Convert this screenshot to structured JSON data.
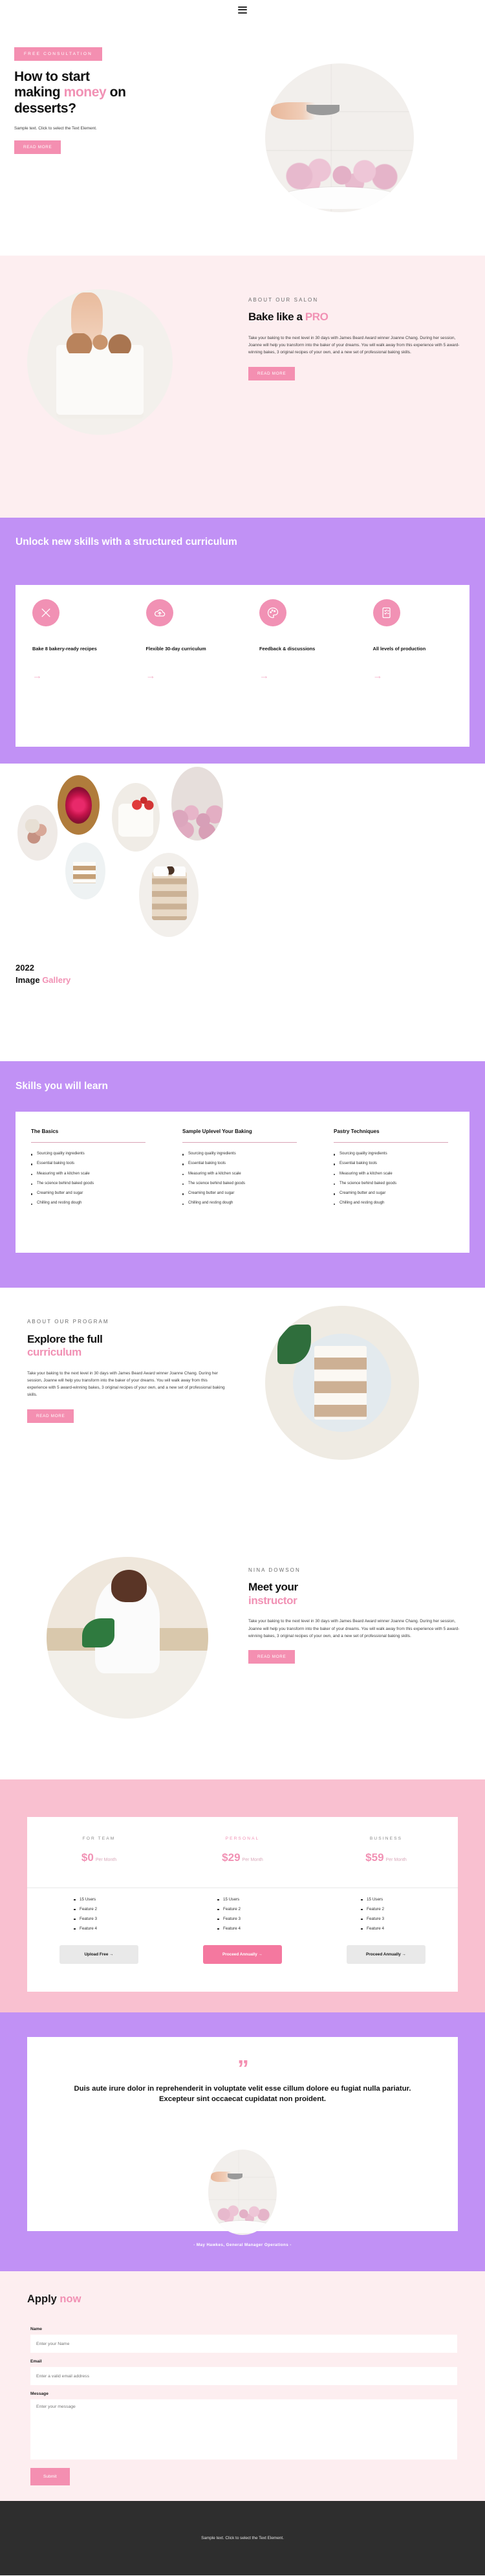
{
  "nav": {
    "menu_icon": "hamburger-menu-icon"
  },
  "hero": {
    "tag": "FREE CONSULTATION",
    "title_1": "How to start",
    "title_2a": "making ",
    "title_2b": "money",
    "title_2c": " on",
    "title_3": "desserts?",
    "body": "Sample text. Click to select the Text Element.",
    "cta": "READ MORE",
    "image": "meringues-on-cake-stand-photo"
  },
  "salon": {
    "eyebrow": "ABOUT OUR SALON",
    "title_a": "Bake like a ",
    "title_b": "PRO",
    "body": "Take your baking to the next level in 30 days with James Beard Award winner Joanne Chang. During her session, Joanne will help you transform into the baker of your dreams. You will walk away from this experience with 5 award-winning bakes, 3 original recipes of your own, and a new set of professional baking skills.",
    "cta": "READ MORE",
    "image": "baker-decorating-cake-photo"
  },
  "unlock": {
    "title": "Unlock new skills with a structured curriculum",
    "cards": [
      {
        "icon": "whisk-icon",
        "title": "Bake 8 bakery-ready recipes",
        "arrow": "→"
      },
      {
        "icon": "cloud-upload-icon",
        "title": "Flexible 30-day curriculum",
        "arrow": "→"
      },
      {
        "icon": "palette-icon",
        "title": "Feedback & discussions",
        "arrow": "→"
      },
      {
        "icon": "checklist-icon",
        "title": "All levels of production",
        "arrow": "→"
      }
    ]
  },
  "gallery": {
    "year": "2022",
    "title_a": "Image ",
    "title_b": "Gallery",
    "images": [
      "macarons-on-plate-photo",
      "red-rose-cake-photo",
      "berry-cheesecake-photo",
      "pink-meringues-photo",
      "layered-cake-slice-photo",
      "chocolate-layer-cake-photo"
    ]
  },
  "skills": {
    "title": "Skills you will learn",
    "columns": [
      {
        "heading": "The Basics",
        "items": [
          "Sourcing quality ingredients",
          "Essential baking tools",
          "Measuring with a kitchen scale",
          "The science behind baked goods",
          "Creaming butter and sugar",
          "Chilling and resting dough"
        ]
      },
      {
        "heading": "Sample Uplevel Your Baking",
        "items": [
          "Sourcing quality ingredients",
          "Essential baking tools",
          "Measuring with a kitchen scale",
          "The science behind baked goods",
          "Creaming butter and sugar",
          "Chilling and resting dough"
        ]
      },
      {
        "heading": "Pastry Techniques",
        "items": [
          "Sourcing quality ingredients",
          "Essential baking tools",
          "Measuring with a kitchen scale",
          "The science behind baked goods",
          "Creaming butter and sugar",
          "Chilling and resting dough"
        ]
      }
    ]
  },
  "explore": {
    "eyebrow": "ABOUT OUR PROGRAM",
    "title_a": "Explore the full",
    "title_b": "curriculum",
    "body": "Take your baking to the next level in 30 days with James Beard Award winner Joanne Chang. During her session, Joanne will help you transform into the baker of your dreams. You will walk away from this experience with 5 award-winning bakes, 3 original recipes of your own, and a new set of professional baking skills.",
    "cta": "READ MORE",
    "image": "cake-slice-on-plate-photo"
  },
  "instructor": {
    "eyebrow": "NINA DOWSON",
    "title_a": "Meet your",
    "title_b": "instructor",
    "body": "Take your baking to the next level in 30 days with James Beard Award winner Joanne Chang. During her session, Joanne will help you transform into the baker of your dreams. You will walk away from this experience with 5 award-winning bakes, 3 original recipes of your own, and a new set of professional baking skills.",
    "cta": "READ MORE",
    "image": "pastry-chef-piping-photo"
  },
  "pricing": {
    "plans": [
      {
        "label": "FOR TEAM",
        "amount": "$0",
        "period": "Per Month",
        "features": [
          "15 Users",
          "Feature 2",
          "Feature 3",
          "Feature 4"
        ],
        "button": "Upload Free →"
      },
      {
        "label": "PERSONAL",
        "amount": "$29",
        "period": "Per Month",
        "features": [
          "15 Users",
          "Feature 2",
          "Feature 3",
          "Feature 4"
        ],
        "button": "Proceed Annually →"
      },
      {
        "label": "BUSINESS",
        "amount": "$59",
        "period": "Per Month",
        "features": [
          "15 Users",
          "Feature 2",
          "Feature 3",
          "Feature 4"
        ],
        "button": "Proceed Annually →"
      }
    ]
  },
  "testimonial": {
    "quote_mark": "”",
    "quote": "Duis aute irure dolor in reprehenderit in voluptate velit esse cillum dolore eu fugiat nulla pariatur. Excepteur sint occaecat cupidatat non proident.",
    "author": "- May Hawkes, General Manager Operations -",
    "image": "meringue-plate-photo"
  },
  "apply": {
    "title_a": "Apply ",
    "title_b": "now",
    "fields": {
      "name_label": "Name",
      "name_placeholder": "Enter your Name",
      "email_label": "Email",
      "email_placeholder": "Enter a valid email address",
      "message_label": "Message",
      "message_placeholder": "Enter your message"
    },
    "submit": "Submit"
  },
  "footer": {
    "text": "Sample text. Click to select the Text Element."
  },
  "colors": {
    "pink": "#f48fb1",
    "pink_light": "#fdeef0",
    "purple": "#c191f5",
    "pink_strong": "#f9c0d0",
    "dark": "#2e2e2e"
  }
}
